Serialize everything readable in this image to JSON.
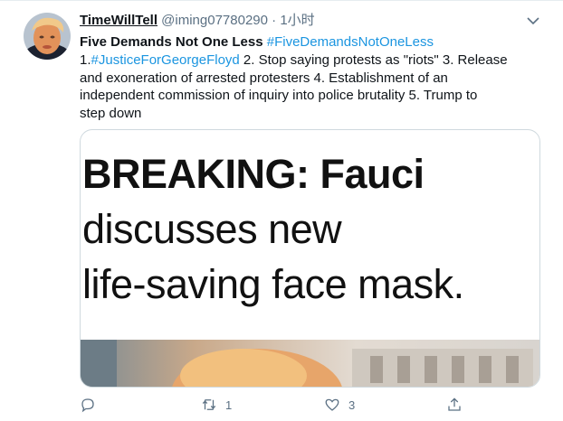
{
  "tweet": {
    "display_name": "TimeWillTell",
    "handle": "@iming07780290",
    "separator": "·",
    "time": "1小时",
    "title": "Five Demands Not One Less",
    "hashtag_title": "#FiveDemandsNotOneLess",
    "body_lines": [
      {
        "prefix": "1.",
        "tag": "#JusticeForGeorgeFloyd",
        "text": "  2. Stop saying protests as \"riots\"  3. Release"
      },
      {
        "prefix": "",
        "tag": "",
        "text": "and exoneration of arrested protesters  4. Establishment of an"
      },
      {
        "prefix": "",
        "tag": "",
        "text": "independent commission of inquiry into police brutality  5. Trump to"
      },
      {
        "prefix": "",
        "tag": "",
        "text": "step down"
      }
    ],
    "media": {
      "headline_bold": "BREAKING: Fauci",
      "headline_line2": "discusses new",
      "headline_line3": "life-saving face mask."
    },
    "actions": {
      "reply_count": "",
      "retweet_count": "1",
      "like_count": "3"
    }
  },
  "colors": {
    "link": "#1b95e0",
    "muted": "#5b7083",
    "border": "#cfd9de"
  },
  "icons": [
    "avatar",
    "chevron-down-icon",
    "reply-icon",
    "retweet-icon",
    "like-icon",
    "share-icon"
  ]
}
